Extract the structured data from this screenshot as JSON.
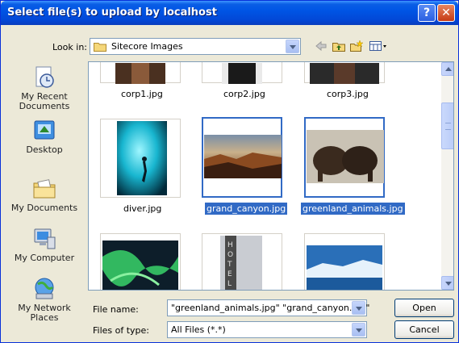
{
  "window": {
    "title": "Select file(s) to upload by localhost",
    "help_glyph": "?",
    "close_glyph": "✕"
  },
  "lookin": {
    "label": "Look in:",
    "value": "Sitecore Images"
  },
  "places": [
    {
      "label_line1": "My Recent",
      "label_line2": "Documents",
      "icon": "recent-documents-icon"
    },
    {
      "label_line1": "Desktop",
      "label_line2": "",
      "icon": "desktop-icon"
    },
    {
      "label_line1": "My Documents",
      "label_line2": "",
      "icon": "my-documents-icon"
    },
    {
      "label_line1": "My Computer",
      "label_line2": "",
      "icon": "my-computer-icon"
    },
    {
      "label_line1": "My Network",
      "label_line2": "Places",
      "icon": "network-places-icon"
    }
  ],
  "files": [
    {
      "name": "corp1.jpg",
      "selected": false
    },
    {
      "name": "corp2.jpg",
      "selected": false
    },
    {
      "name": "corp3.jpg",
      "selected": false
    },
    {
      "name": "diver.jpg",
      "selected": false
    },
    {
      "name": "grand_canyon.jpg",
      "selected": true
    },
    {
      "name": "greenland_animals.jpg",
      "selected": true
    }
  ],
  "filename": {
    "label": "File name:",
    "value": "\"greenland_animals.jpg\" \"grand_canyon.jpg\""
  },
  "filetype": {
    "label": "Files of type:",
    "value": "All Files (*.*)"
  },
  "buttons": {
    "open": "Open",
    "cancel": "Cancel"
  },
  "colors": {
    "title_bar": "#0055e5",
    "selection": "#316ac5",
    "dialog_bg": "#ece9d8"
  }
}
